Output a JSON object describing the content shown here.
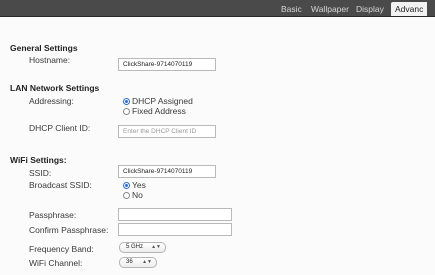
{
  "nav": {
    "tabs": [
      {
        "label": "Basic",
        "active": false
      },
      {
        "label": "Wallpaper",
        "active": false
      },
      {
        "label": "Display",
        "active": false
      },
      {
        "label": "Advanc",
        "active": true
      }
    ]
  },
  "general": {
    "title": "General Settings",
    "hostname_label": "Hostname:",
    "hostname_value": "ClickShare-9714070119"
  },
  "lan": {
    "title": "LAN Network Settings",
    "addressing_label": "Addressing:",
    "options": [
      {
        "label": "DHCP Assigned",
        "checked": true
      },
      {
        "label": "Fixed Address",
        "checked": false
      }
    ],
    "dhcp_client_label": "DHCP Client ID:",
    "dhcp_client_placeholder": "Enter the DHCP Client ID"
  },
  "wifi": {
    "title": "WiFi Settings:",
    "ssid_label": "SSID:",
    "ssid_value": "ClickShare-9714070119",
    "broadcast_label": "Broadcast SSID:",
    "broadcast_options": [
      {
        "label": "Yes",
        "checked": true
      },
      {
        "label": "No",
        "checked": false
      }
    ],
    "passphrase_label": "Passphrase:",
    "confirm_label": "Confirm Passphrase:",
    "band_label": "Frequency Band:",
    "band_value": "5 GHz",
    "channel_label": "WiFi Channel:",
    "channel_value": "36"
  }
}
